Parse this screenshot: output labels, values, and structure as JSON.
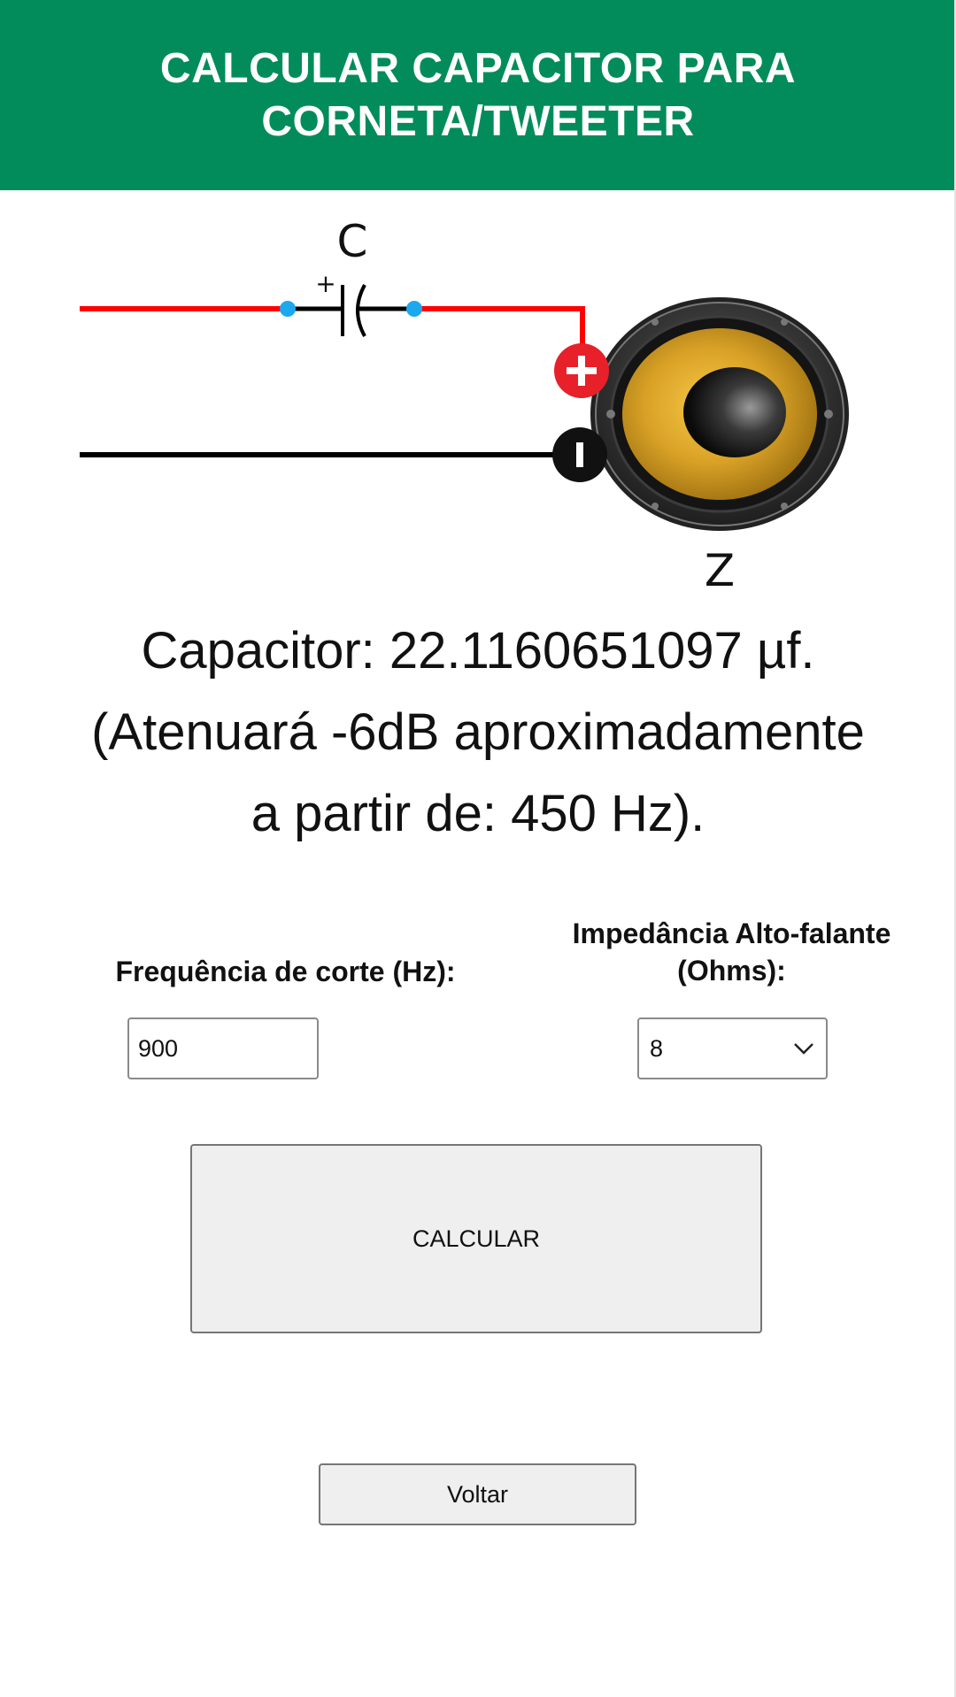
{
  "header": {
    "title": "CALCULAR CAPACITOR PARA CORNETA/TWEETER"
  },
  "diagram": {
    "capacitor_label": "C",
    "capacitor_polarity": "+",
    "speaker_label": "Z",
    "wire_positive_color": "#ff0000",
    "wire_negative_color": "#000000",
    "node_color": "#1ba8ee",
    "terminal_positive_color": "#e8202a",
    "terminal_negative_color": "#111111",
    "speaker_cone_color": "#d4a020"
  },
  "result": {
    "line1": "Capacitor: 22.1160651097 µf.",
    "line2": "(Atenuará -6dB aproximadamente",
    "line3": "a partir de: 450 Hz)."
  },
  "form": {
    "frequency_label": "Frequência de corte (Hz):",
    "frequency_value": "900",
    "impedance_label_line1": "Impedância Alto-falante",
    "impedance_label_line2": "(Ohms):",
    "impedance_value": "8"
  },
  "buttons": {
    "calculate_label": "CALCULAR",
    "back_label": "Voltar"
  },
  "colors": {
    "header_bg": "#028c5b",
    "header_text": "#ffffff",
    "button_bg": "#efefef"
  }
}
